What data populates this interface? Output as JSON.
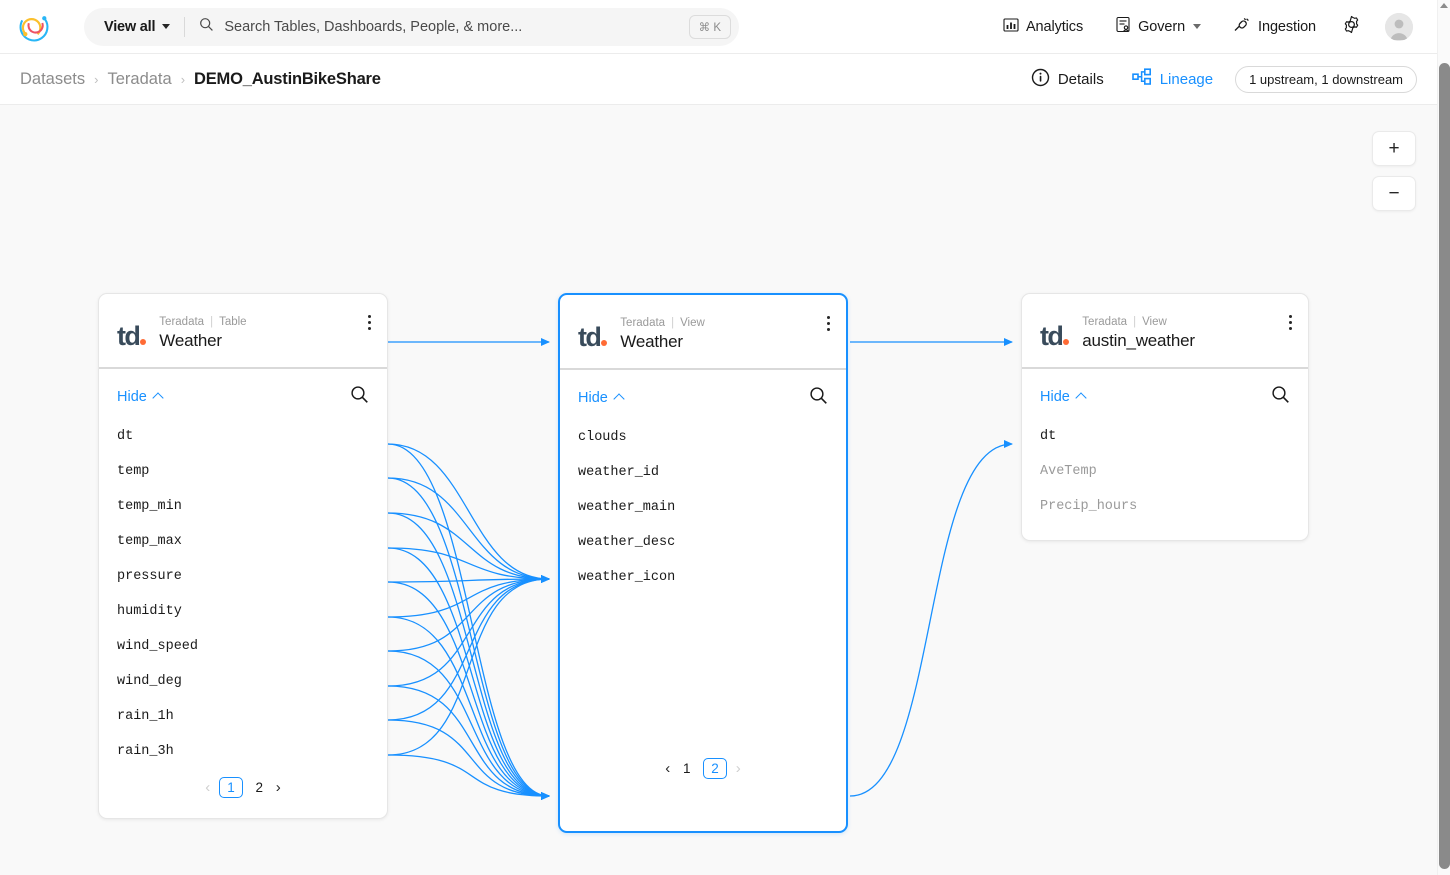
{
  "topnav": {
    "logo_icon": "datahub-logo-icon",
    "view_all_label": "View all",
    "search": {
      "icon": "search-icon",
      "placeholder": "Search Tables, Dashboards, People, & more...",
      "value": "",
      "shortcut": "⌘ K"
    },
    "items": [
      {
        "label": "Analytics",
        "icon": "bar-chart-icon",
        "has_caret": false
      },
      {
        "label": "Govern",
        "icon": "governance-icon",
        "has_caret": true
      },
      {
        "label": "Ingestion",
        "icon": "plug-icon",
        "has_caret": false
      }
    ],
    "settings_icon": "gear-icon",
    "avatar_icon": "avatar-icon"
  },
  "breadcrumb": {
    "items": [
      {
        "label": "Datasets",
        "current": false
      },
      {
        "label": "Teradata",
        "current": false
      },
      {
        "label": "DEMO_AustinBikeShare",
        "current": true
      }
    ],
    "separator": "›"
  },
  "tabs": [
    {
      "label": "Details",
      "icon": "info-circle-icon",
      "active": false
    },
    {
      "label": "Lineage",
      "icon": "lineage-icon",
      "active": true
    }
  ],
  "lineage_badge": "1 upstream, 1 downstream",
  "canvas": {
    "zoom_in_label": "+",
    "zoom_out_label": "−",
    "background": "#f9f9f9",
    "edge_color": "#1890ff"
  },
  "nodes": [
    {
      "id": "weather-table",
      "platform": "Teradata",
      "entity_type": "Table",
      "title": "Weather",
      "logo": "teradata-logo-icon",
      "selected": false,
      "hide_label": "Hide",
      "search_icon": "search-icon",
      "menu_icon": "kebab-menu-icon",
      "columns": [
        {
          "name": "dt",
          "dim": false
        },
        {
          "name": "temp",
          "dim": false
        },
        {
          "name": "temp_min",
          "dim": false
        },
        {
          "name": "temp_max",
          "dim": false
        },
        {
          "name": "pressure",
          "dim": false
        },
        {
          "name": "humidity",
          "dim": false
        },
        {
          "name": "wind_speed",
          "dim": false
        },
        {
          "name": "wind_deg",
          "dim": false
        },
        {
          "name": "rain_1h",
          "dim": false
        },
        {
          "name": "rain_3h",
          "dim": false
        }
      ],
      "pagination": {
        "prev": "‹",
        "next": "›",
        "pages": [
          "1",
          "2"
        ],
        "active": "1",
        "prev_disabled": true,
        "next_disabled": false
      }
    },
    {
      "id": "weather-view",
      "platform": "Teradata",
      "entity_type": "View",
      "title": "Weather",
      "logo": "teradata-logo-icon",
      "selected": true,
      "hide_label": "Hide",
      "search_icon": "search-icon",
      "menu_icon": "kebab-menu-icon",
      "columns": [
        {
          "name": "clouds",
          "dim": false
        },
        {
          "name": "weather_id",
          "dim": false
        },
        {
          "name": "weather_main",
          "dim": false
        },
        {
          "name": "weather_desc",
          "dim": false
        },
        {
          "name": "weather_icon",
          "dim": false
        }
      ],
      "pagination": {
        "prev": "‹",
        "next": "›",
        "pages": [
          "1",
          "2"
        ],
        "active": "2",
        "prev_disabled": false,
        "next_disabled": true
      }
    },
    {
      "id": "austin-weather-view",
      "platform": "Teradata",
      "entity_type": "View",
      "title": "austin_weather",
      "logo": "teradata-logo-icon",
      "selected": false,
      "hide_label": "Hide",
      "search_icon": "search-icon",
      "menu_icon": "kebab-menu-icon",
      "columns": [
        {
          "name": "dt",
          "dim": false
        },
        {
          "name": "AveTemp",
          "dim": true
        },
        {
          "name": "Precip_hours",
          "dim": true
        }
      ],
      "pagination": null
    }
  ]
}
